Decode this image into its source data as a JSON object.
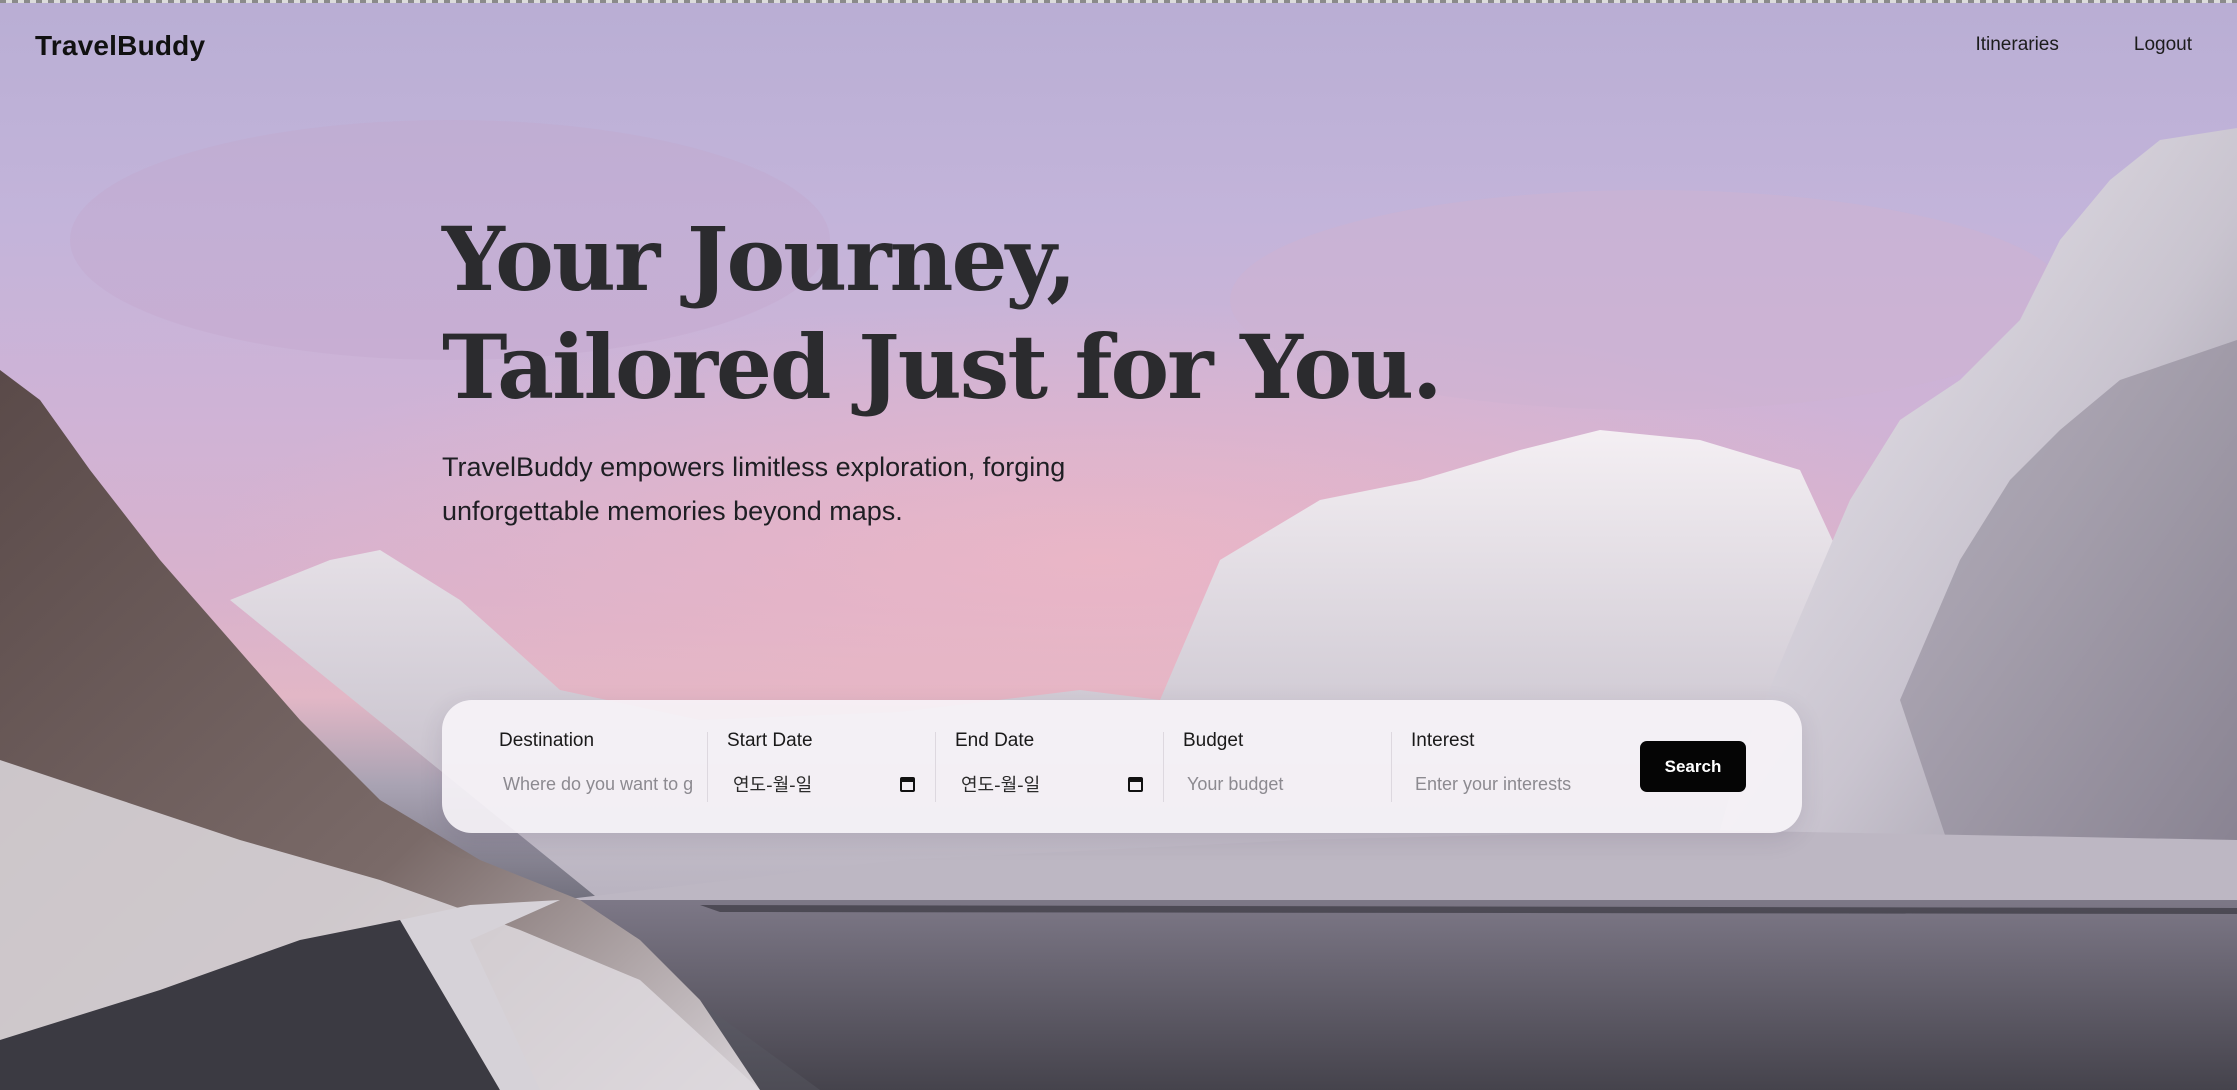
{
  "brand": "TravelBuddy",
  "nav": {
    "itineraries": "Itineraries",
    "logout": "Logout"
  },
  "hero": {
    "title_line1": "Your Journey,",
    "title_line2": "Tailored Just for You.",
    "subtitle_line1": "TravelBuddy empowers limitless exploration, forging",
    "subtitle_line2": "unforgettable memories beyond maps."
  },
  "search": {
    "destination": {
      "label": "Destination",
      "placeholder": "Where do you want to go?"
    },
    "start_date": {
      "label": "Start Date",
      "value": "연도-월-일"
    },
    "end_date": {
      "label": "End Date",
      "value": "연도-월-일"
    },
    "budget": {
      "label": "Budget",
      "placeholder": "Your budget"
    },
    "interest": {
      "label": "Interest",
      "placeholder": "Enter your interests"
    },
    "button_label": "Search"
  },
  "colors": {
    "sky_top": "#b9aed4",
    "sky_glow": "#e2b7c6",
    "text_dark": "#2b2b2e",
    "button_bg": "#050505"
  },
  "icons": [
    "calendar-icon"
  ]
}
